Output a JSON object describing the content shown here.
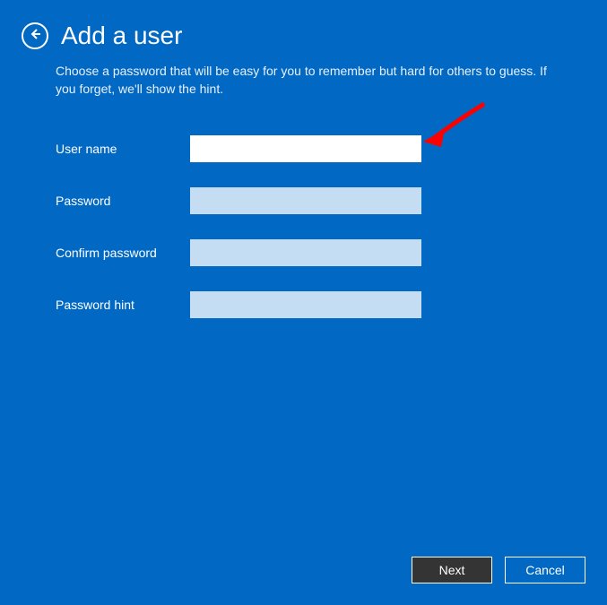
{
  "header": {
    "title": "Add a user"
  },
  "description": "Choose a password that will be easy for you to remember but hard for others to guess. If you forget, we'll show the hint.",
  "form": {
    "username": {
      "label": "User name",
      "value": ""
    },
    "password": {
      "label": "Password",
      "value": ""
    },
    "confirm": {
      "label": "Confirm password",
      "value": ""
    },
    "hint": {
      "label": "Password hint",
      "value": ""
    }
  },
  "buttons": {
    "next": "Next",
    "cancel": "Cancel"
  },
  "annotation": {
    "arrow_color": "#ff0000"
  }
}
